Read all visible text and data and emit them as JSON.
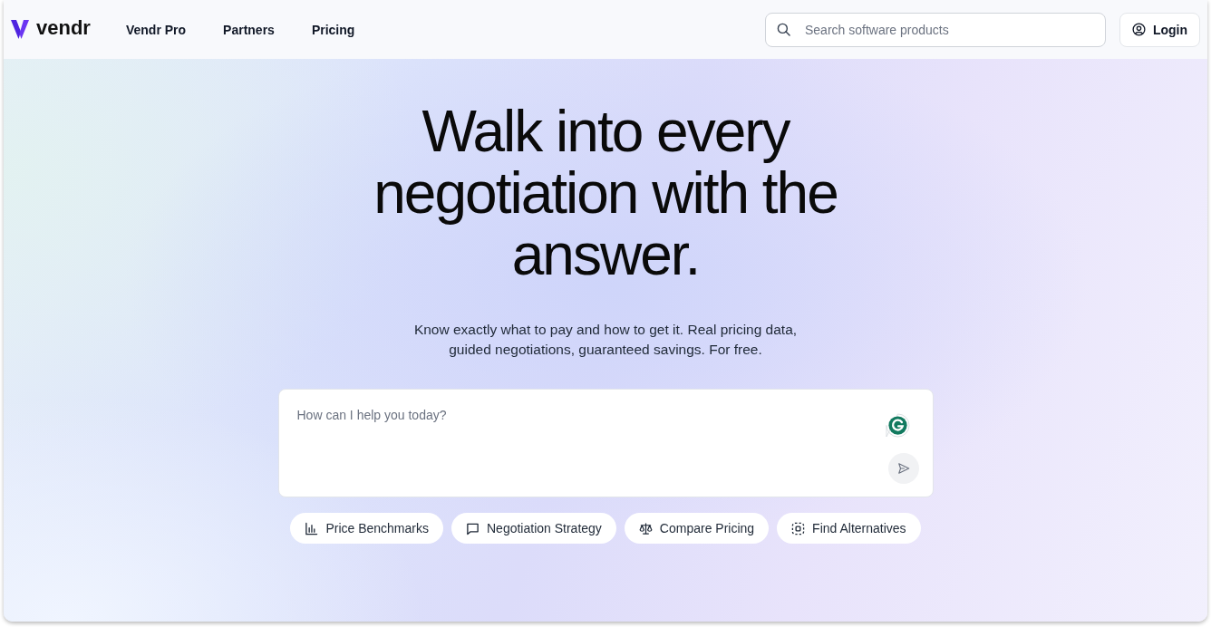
{
  "header": {
    "logo": {
      "text": "vendr"
    },
    "nav": [
      {
        "label": "Vendr Pro"
      },
      {
        "label": "Partners"
      },
      {
        "label": "Pricing"
      }
    ],
    "search": {
      "placeholder": "Search software products"
    },
    "login": {
      "label": "Login"
    }
  },
  "hero": {
    "title": "Walk into every negotiation with the answer.",
    "subtitle": "Know exactly what to pay and how to get it. Real pricing data, guided negotiations, guaranteed savings. For free."
  },
  "prompt": {
    "placeholder": "How can I help you today?"
  },
  "chips": [
    {
      "label": "Price Benchmarks",
      "kind": "chart"
    },
    {
      "label": "Negotiation Strategy",
      "kind": "chat"
    },
    {
      "label": "Compare Pricing",
      "kind": "scale"
    },
    {
      "label": "Find Alternatives",
      "kind": "scan"
    }
  ]
}
